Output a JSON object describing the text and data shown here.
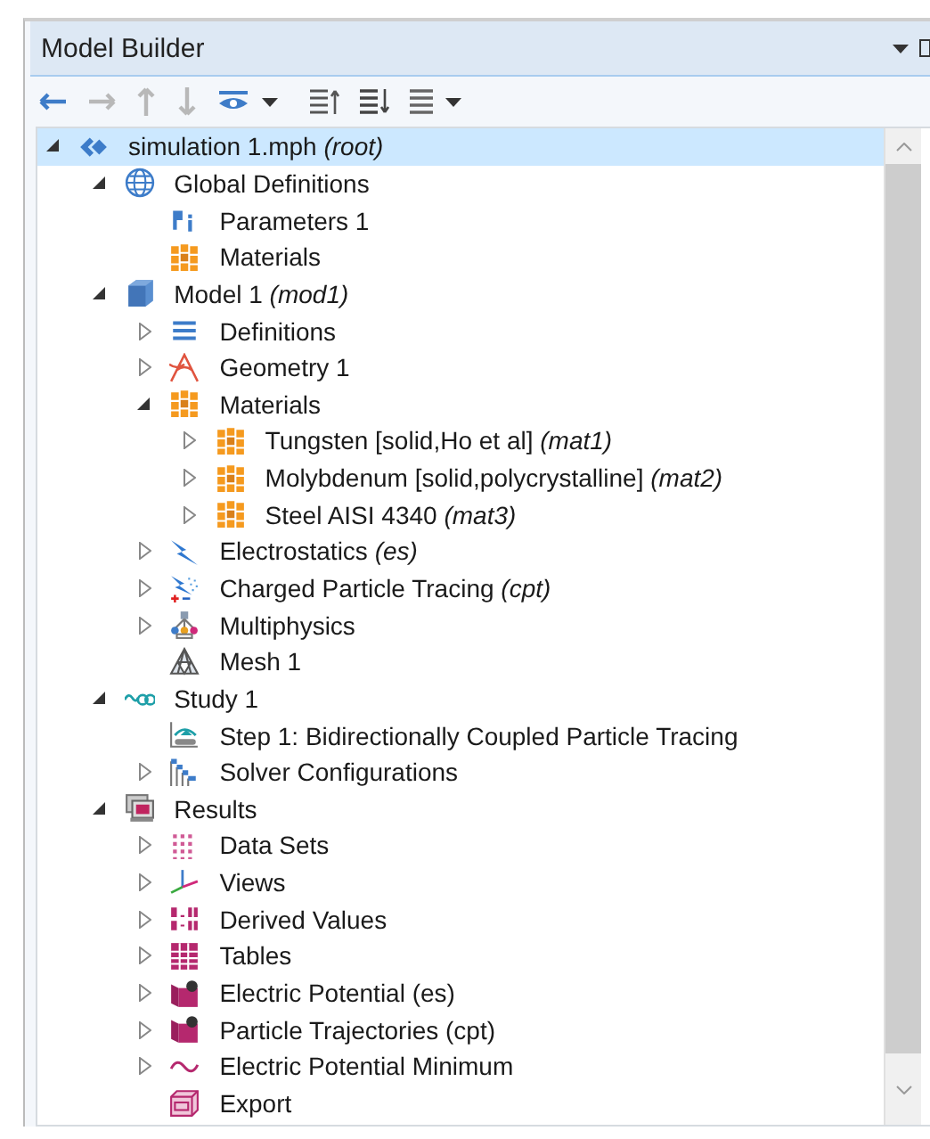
{
  "panel": {
    "title": "Model Builder"
  },
  "toolbar": [
    {
      "kind": "back",
      "disabled": false
    },
    {
      "kind": "forward",
      "disabled": true
    },
    {
      "kind": "up",
      "disabled": true
    },
    {
      "kind": "down",
      "disabled": true
    },
    {
      "kind": "eye",
      "disabled": false
    },
    {
      "kind": "caret",
      "disabled": false
    },
    {
      "kind": "collapse",
      "disabled": false
    },
    {
      "kind": "expand",
      "disabled": false
    },
    {
      "kind": "list",
      "disabled": false
    },
    {
      "kind": "caret",
      "disabled": false
    }
  ],
  "tree": [
    {
      "label": "simulation 1.mph *(root)*",
      "kind": "model-file",
      "expanded": true,
      "selected": true,
      "children": [
        {
          "label": "Global Definitions",
          "kind": "globe",
          "expanded": true,
          "selected": false,
          "children": [
            {
              "label": "Parameters 1",
              "kind": "parameters",
              "selected": false
            },
            {
              "label": "Materials",
              "kind": "materials",
              "selected": false
            }
          ]
        },
        {
          "label": "Model 1 *(mod1)*",
          "kind": "cube",
          "expanded": true,
          "selected": false,
          "children": [
            {
              "label": "Definitions",
              "kind": "definitions",
              "expanded": false,
              "selected": false
            },
            {
              "label": "Geometry 1",
              "kind": "geometry",
              "expanded": false,
              "selected": false
            },
            {
              "label": "Materials",
              "kind": "materials",
              "expanded": true,
              "selected": false,
              "children": [
                {
                  "label": "Tungsten [solid,Ho et al] *(mat1)*",
                  "kind": "materials",
                  "expanded": false,
                  "selected": false
                },
                {
                  "label": "Molybdenum [solid,polycrystalline] *(mat2)*",
                  "kind": "materials",
                  "expanded": false,
                  "selected": false
                },
                {
                  "label": "Steel AISI 4340 *(mat3)*",
                  "kind": "materials",
                  "expanded": false,
                  "selected": false
                }
              ]
            },
            {
              "label": "Electrostatics *(es)*",
              "kind": "lightning",
              "expanded": false,
              "selected": false
            },
            {
              "label": "Charged Particle Tracing *(cpt)*",
              "kind": "particles",
              "expanded": false,
              "selected": false
            },
            {
              "label": "Multiphysics",
              "kind": "multiphysics",
              "expanded": false,
              "selected": false
            },
            {
              "label": "Mesh 1",
              "kind": "mesh",
              "selected": false
            }
          ]
        },
        {
          "label": "Study 1",
          "kind": "study",
          "expanded": true,
          "selected": false,
          "children": [
            {
              "label": "Step 1: Bidirectionally Coupled Particle Tracing",
              "kind": "step",
              "selected": false
            },
            {
              "label": "Solver Configurations",
              "kind": "solver",
              "expanded": false,
              "selected": false
            }
          ]
        },
        {
          "label": "Results",
          "kind": "results",
          "expanded": true,
          "selected": false,
          "children": [
            {
              "label": "Data Sets",
              "kind": "datasets",
              "expanded": false,
              "selected": false
            },
            {
              "label": "Views",
              "kind": "axes",
              "expanded": false,
              "selected": false
            },
            {
              "label": "Derived Values",
              "kind": "derived",
              "expanded": false,
              "selected": false
            },
            {
              "label": "Tables",
              "kind": "table",
              "expanded": false,
              "selected": false
            },
            {
              "label": "Electric Potential (es)",
              "kind": "plot",
              "expanded": false,
              "selected": false
            },
            {
              "label": "Particle Trajectories (cpt)",
              "kind": "plot",
              "expanded": false,
              "selected": false
            },
            {
              "label": "Electric Potential Minimum",
              "kind": "wave",
              "expanded": false,
              "selected": false
            },
            {
              "label": "Export",
              "kind": "export",
              "selected": false
            }
          ]
        }
      ]
    }
  ]
}
